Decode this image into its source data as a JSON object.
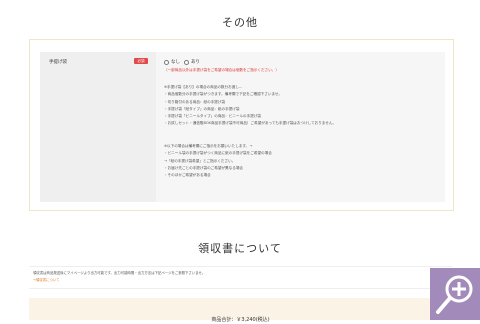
{
  "section_title": "その他",
  "form": {
    "label": "手提げ袋",
    "required_badge": "必須",
    "options": [
      "なし",
      "あり"
    ],
    "notice": "（一部商品以外は手提げ袋をご希望の場合は個数をご指示ください。）",
    "list1": [
      "※手提げ袋【あり】の場合の商品の数分お渡し…",
      "・商品個数分の手提げ袋がつきます。備考欄で下記をご確認下さいませ。",
      "・切り箱付のある商品：紙の手提げ袋",
      "・手提げ袋「紙タイプ」の商品：紙の手提げ袋",
      "・手提げ袋「ビニールタイプ」の商品：ビニールの手提げ袋",
      "・お試しセット・通信販BOX商品手提げ袋不可商品）ご希望があっても手提げ袋はおつけしておりません。"
    ],
    "list2": [
      "※以下の場合は備考欄にご指示をお願いいたします。→",
      "・ビニール袋の手提げ袋がつく商品に紙の手提げ袋をご希望の場合",
      "→「紙の手提げ袋希望」とご指示ください。",
      "・お届け先ごとの手提げ袋のご希望が異なる場合",
      "・そのほかご希望がある場合"
    ]
  },
  "receipt": {
    "title": "領収書について",
    "text": "領収書は商品発送後にマイページより出力可能です。出力可能時間・出力方法は下記ページをご参照下さいませ。",
    "link": "→領収書について"
  },
  "total": {
    "label": "商品合計：￥3,240(税込)"
  },
  "zoom_button": {
    "icon": "zoom-in-icon",
    "color": "#a28bbb"
  }
}
